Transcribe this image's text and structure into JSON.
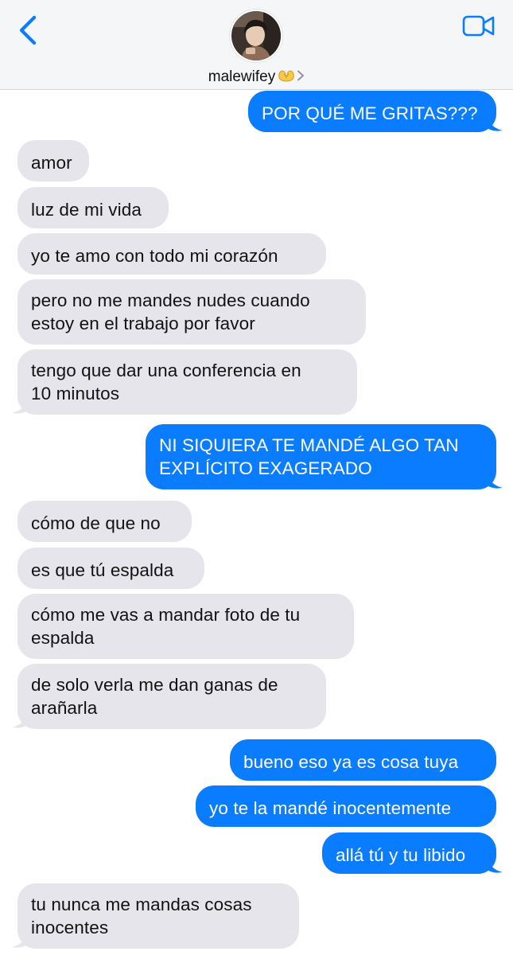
{
  "header": {
    "back_icon": "chevron-left-icon",
    "video_icon": "video-camera-icon",
    "contact_name": "malewifey",
    "contact_emoji": "🫶",
    "accent_color": "#0a7cff"
  },
  "messages": [
    {
      "id": "m1",
      "direction": "outgoing",
      "text": "POR QUÉ ME GRITAS???"
    },
    {
      "id": "m2",
      "direction": "incoming",
      "text": "amor"
    },
    {
      "id": "m3",
      "direction": "incoming",
      "text": "luz de mi vida"
    },
    {
      "id": "m4",
      "direction": "incoming",
      "text": "yo te amo con todo mi corazón"
    },
    {
      "id": "m5",
      "direction": "incoming",
      "lines": [
        "pero no me mandes nudes cuando",
        "estoy en el trabajo por favor"
      ]
    },
    {
      "id": "m6",
      "direction": "incoming",
      "lines": [
        "tengo que dar una conferencia en",
        "10 minutos"
      ]
    },
    {
      "id": "m7",
      "direction": "outgoing",
      "lines": [
        "NI SIQUIERA TE MANDÉ ALGO TAN",
        "EXPLÍCITO EXAGERADO"
      ]
    },
    {
      "id": "m8",
      "direction": "incoming",
      "text": "cómo de que no"
    },
    {
      "id": "m9",
      "direction": "incoming",
      "text": "es que tú espalda"
    },
    {
      "id": "m10",
      "direction": "incoming",
      "lines": [
        "cómo me vas a mandar foto de tu",
        "espalda"
      ]
    },
    {
      "id": "m11",
      "direction": "incoming",
      "lines": [
        "de solo verla me dan ganas de",
        "arañarla"
      ]
    },
    {
      "id": "m12",
      "direction": "outgoing",
      "text": "bueno eso ya es cosa tuya"
    },
    {
      "id": "m13",
      "direction": "outgoing",
      "text": "yo te la mandé inocentemente"
    },
    {
      "id": "m14",
      "direction": "outgoing",
      "text": "allá tú y tu libido"
    },
    {
      "id": "m15",
      "direction": "incoming",
      "lines": [
        "tu nunca me mandas cosas",
        "inocentes"
      ]
    }
  ],
  "colors": {
    "incoming_bubble": "#e6e5eb",
    "outgoing_bubble": "#0a7cff",
    "header_bg": "#f5f6f8"
  }
}
